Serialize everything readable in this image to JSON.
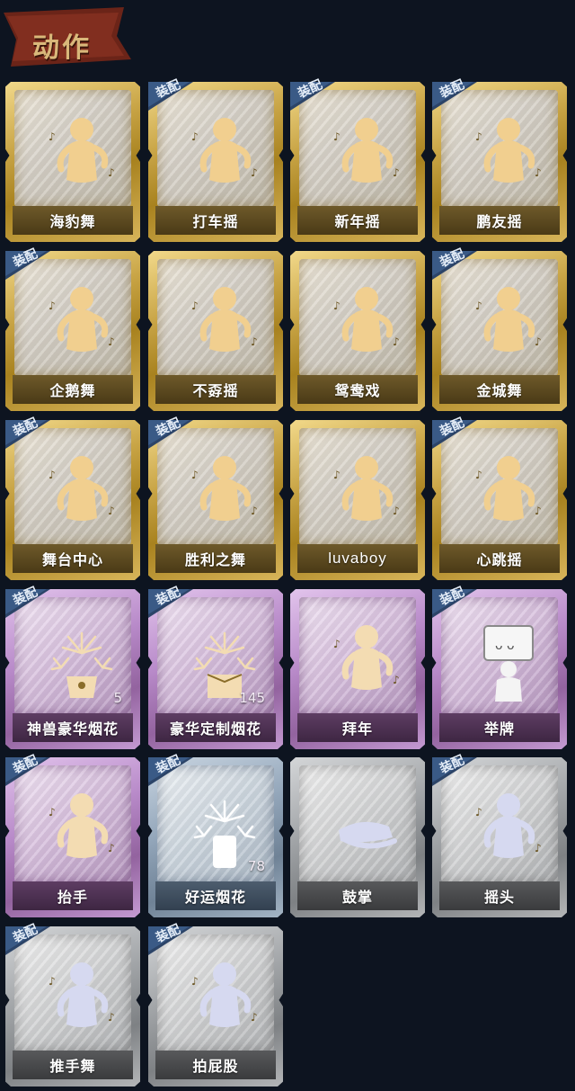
{
  "header": {
    "title": "动作"
  },
  "badge_text": "装配",
  "colors": {
    "background": "#0d1420",
    "gold_frame": "#c8a445",
    "purple_frame": "#b88ac9",
    "blue_frame": "#93a6ba",
    "gray_frame": "#a2a5a8",
    "title_text": "#d9b87a",
    "title_ribbon": "#6b2418"
  },
  "cards": [
    {
      "label": "海豹舞",
      "rarity": "gold",
      "equipped": false,
      "icon": "seal-dance-figure-icon"
    },
    {
      "label": "打车摇",
      "rarity": "gold",
      "equipped": true,
      "icon": "taxi-shake-figure-icon"
    },
    {
      "label": "新年摇",
      "rarity": "gold",
      "equipped": true,
      "icon": "new-year-shake-figure-icon"
    },
    {
      "label": "鹏友摇",
      "rarity": "gold",
      "equipped": true,
      "icon": "friend-shake-figure-icon"
    },
    {
      "label": "企鹅舞",
      "rarity": "gold",
      "equipped": true,
      "icon": "penguin-dance-figure-icon"
    },
    {
      "label": "不孬摇",
      "rarity": "gold",
      "equipped": false,
      "icon": "not-bad-shake-figure-icon"
    },
    {
      "label": "鸳鸯戏",
      "rarity": "gold",
      "equipped": false,
      "icon": "mandarin-duck-play-figure-icon"
    },
    {
      "label": "金城舞",
      "rarity": "gold",
      "equipped": true,
      "icon": "golden-city-dance-figure-icon"
    },
    {
      "label": "舞台中心",
      "rarity": "gold",
      "equipped": true,
      "icon": "stage-center-figure-icon"
    },
    {
      "label": "胜利之舞",
      "rarity": "gold",
      "equipped": true,
      "icon": "victory-dance-figure-icon"
    },
    {
      "label": "luvaboy",
      "rarity": "gold",
      "equipped": false,
      "icon": "luvaboy-figure-icon"
    },
    {
      "label": "心跳摇",
      "rarity": "gold",
      "equipped": true,
      "icon": "heartbeat-shake-figure-icon"
    },
    {
      "label": "神兽豪华烟花",
      "rarity": "purple",
      "equipped": true,
      "icon": "deluxe-firework-pot-icon",
      "count": "5"
    },
    {
      "label": "豪华定制烟花",
      "rarity": "purple",
      "equipped": true,
      "icon": "custom-firework-box-icon",
      "count": "145"
    },
    {
      "label": "拜年",
      "rarity": "purple",
      "equipped": false,
      "icon": "new-year-greeting-figure-icon"
    },
    {
      "label": "举牌",
      "rarity": "purple",
      "equipped": true,
      "icon": "hold-sign-figure-icon"
    },
    {
      "label": "抬手",
      "rarity": "purple",
      "equipped": true,
      "icon": "raise-hand-figure-icon"
    },
    {
      "label": "好运烟花",
      "rarity": "blue",
      "equipped": true,
      "icon": "lucky-firework-can-icon",
      "count": "78"
    },
    {
      "label": "鼓掌",
      "rarity": "gray",
      "equipped": false,
      "icon": "clapping-hands-icon"
    },
    {
      "label": "摇头",
      "rarity": "gray",
      "equipped": true,
      "icon": "shake-head-figure-icon"
    },
    {
      "label": "推手舞",
      "rarity": "gray",
      "equipped": true,
      "icon": "push-hand-dance-figure-icon"
    },
    {
      "label": "拍屁股",
      "rarity": "gray",
      "equipped": true,
      "icon": "pat-butt-figure-icon"
    }
  ]
}
